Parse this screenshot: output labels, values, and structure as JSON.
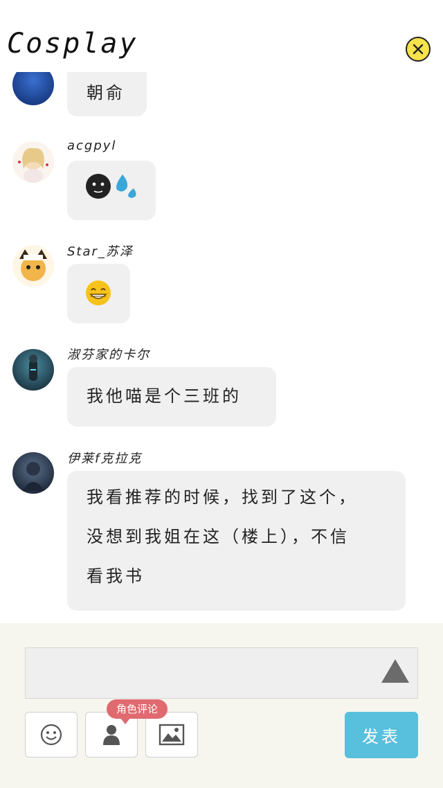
{
  "header": {
    "title": "Cosplay",
    "close_icon": "close-circle-icon"
  },
  "messages": [
    {
      "name": "",
      "text": "朝俞"
    },
    {
      "name": "acgpyl",
      "emojis": [
        "dark-face-emoji",
        "sweat-drop-emoji"
      ]
    },
    {
      "name": "Star_苏泽",
      "emojis": [
        "grin-emoji"
      ]
    },
    {
      "name": "淑芬家的卡尔",
      "text": "我他喵是个三班的"
    },
    {
      "name": "伊莱f克拉克",
      "text": "我看推荐的时候，找到了这个，\n没想到我姐在这（楼上），不信\n看我书"
    }
  ],
  "composer": {
    "input_value": "",
    "send_icon": "triangle-up-icon",
    "role_tag": "角色评论",
    "tools": [
      "smiley-icon",
      "person-icon",
      "image-icon"
    ],
    "post_label": "发表"
  },
  "colors": {
    "accent": "#58bfdc",
    "tag": "#e06a6f",
    "close": "#f6e24a",
    "bubble": "#f0f0f0"
  }
}
